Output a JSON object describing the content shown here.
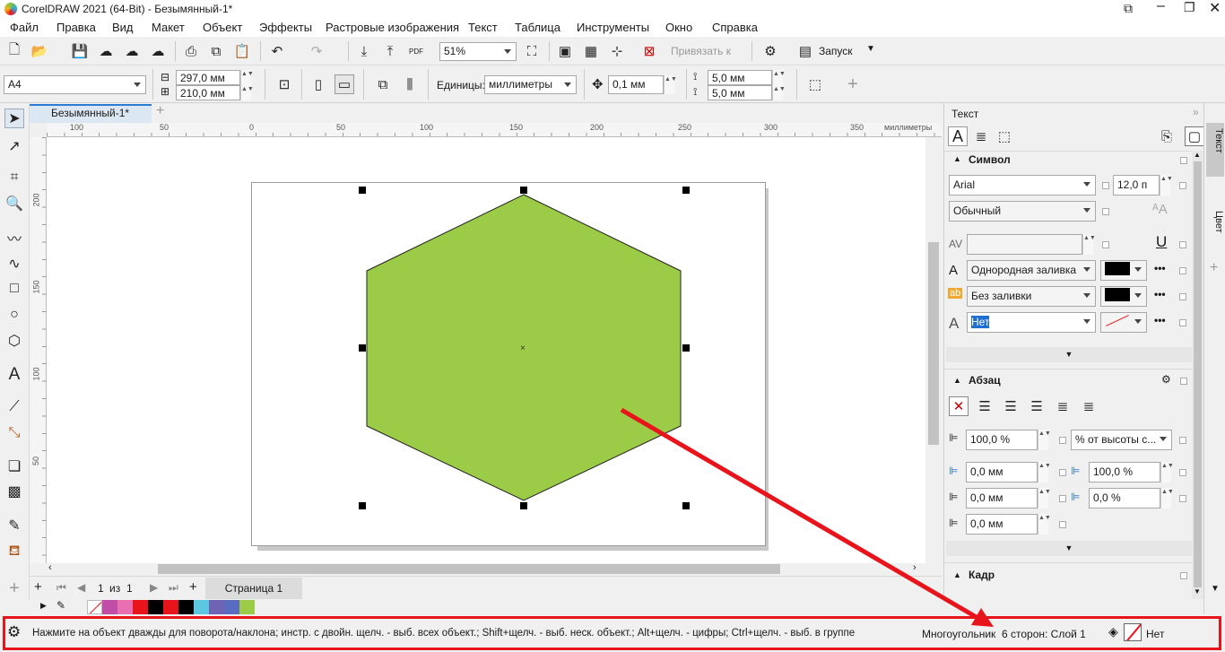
{
  "window": {
    "title": "CorelDRAW 2021 (64-Bit) - Безымянный-1*"
  },
  "menu": [
    "Файл",
    "Правка",
    "Вид",
    "Макет",
    "Объект",
    "Эффекты",
    "Растровые изображения",
    "Текст",
    "Таблица",
    "Инструменты",
    "Окно",
    "Справка"
  ],
  "toolbar": {
    "zoom": "51%",
    "snap_label": "Привязать к",
    "launch_label": "Запуск"
  },
  "property_bar": {
    "page_size": "A4",
    "width": "297,0 мм",
    "height": "210,0 мм",
    "units_label": "Единицы:",
    "units": "миллиметры",
    "nudge": "0,1 мм",
    "dup_x": "5,0 мм",
    "dup_y": "5,0 мм"
  },
  "document": {
    "tab_name": "Безымянный-1*"
  },
  "rulers": {
    "units": "миллиметры",
    "h_ticks": [
      "100",
      "50",
      "0",
      "50",
      "100",
      "150",
      "200",
      "250",
      "300",
      "350"
    ],
    "v_ticks": [
      "200",
      "150",
      "100",
      "50"
    ]
  },
  "shape": {
    "fill": "#9ccb48",
    "type": "hexagon"
  },
  "pages": {
    "current": "1",
    "of_label": "из",
    "total": "1",
    "page_tab": "Страница 1"
  },
  "palette_colors": [
    "#c14ea6",
    "#e96fb0",
    "#e8141b",
    "#000000",
    "#e8141b",
    "#000000",
    "#5bc8e0",
    "#6f63b3",
    "#5a6cc0",
    "#9ccb48"
  ],
  "panel": {
    "title": "Текст",
    "char_section": "Символ",
    "font": "Arial",
    "font_size": "12,0 п",
    "font_style": "Обычный",
    "fill_type": "Однородная заливка",
    "bg_fill": "Без заливки",
    "outline": "Нет",
    "para_section": "Абзац",
    "line_spacing": "100,0 %",
    "line_spacing_unit": "% от высоты с...",
    "indent_left": "0,0 мм",
    "indent_first": "0,0 мм",
    "indent_right": "0,0 мм",
    "char_spacing": "100,0 %",
    "word_spacing": "0,0 %",
    "frame_section": "Кадр"
  },
  "side_tabs": [
    "Текст",
    "Цвет"
  ],
  "status": {
    "hint": "Нажмите на объект дважды для поворота/наклона; инстр. с двойн. щелч. - выб. всех объект.; Shift+щелч. - выб. неск. объект.; Alt+щелч. - цифры; Ctrl+щелч. - выб. в группе",
    "object_info": "Многоугольник  6 сторон: Слой 1",
    "outline": "Нет"
  },
  "annotation": {
    "color": "#e8141b"
  }
}
